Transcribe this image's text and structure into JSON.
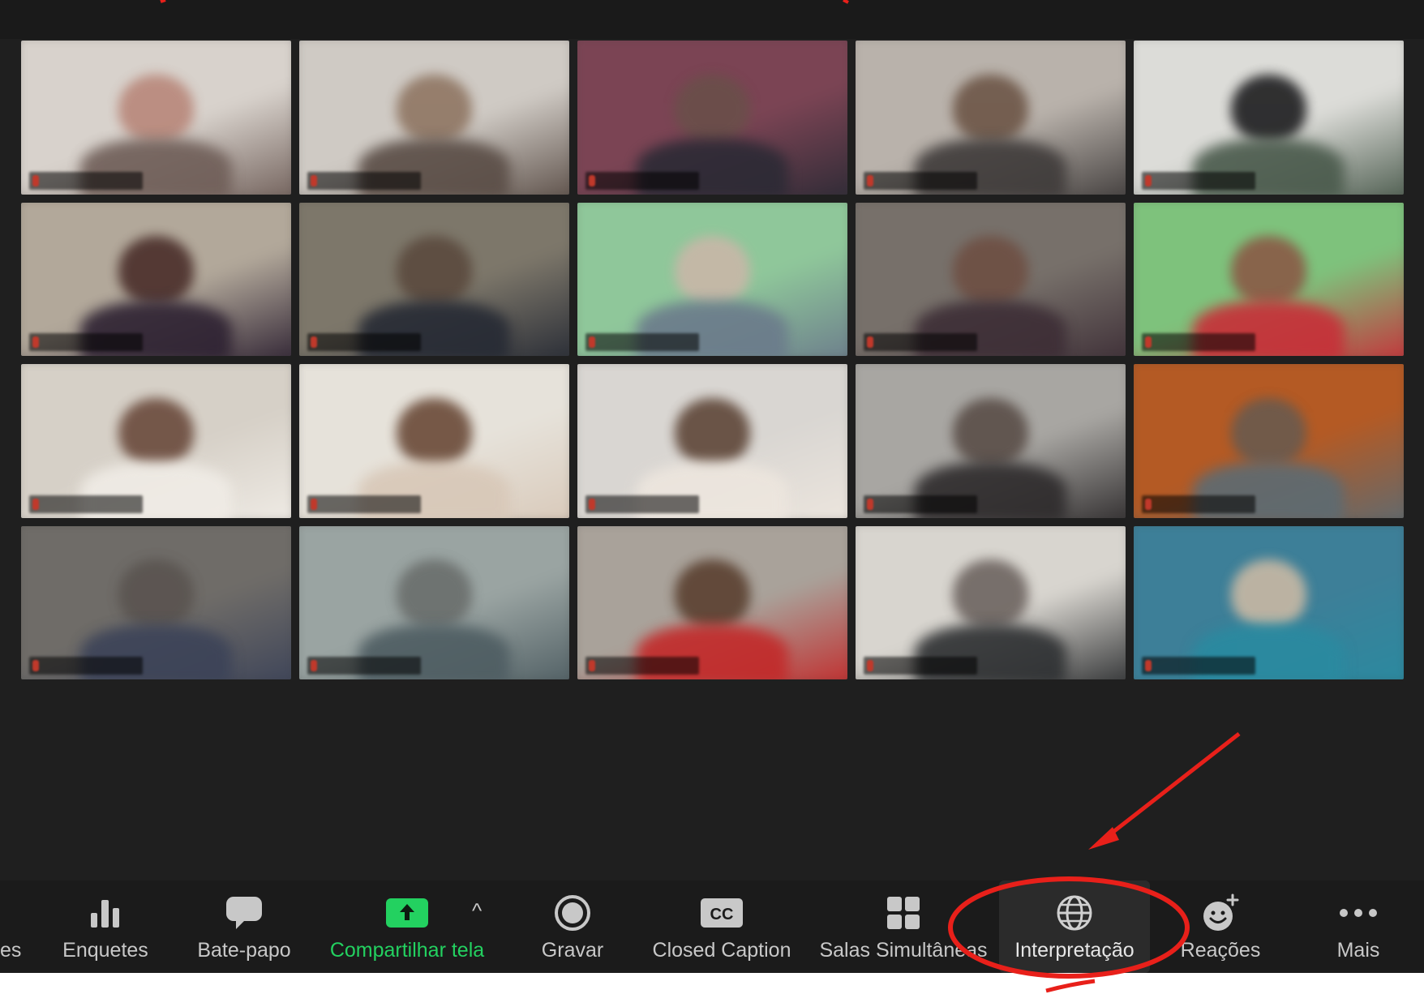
{
  "toolbar": {
    "partial_left_label": "es",
    "items": [
      {
        "id": "polls",
        "label": "Enquetes",
        "icon": "bar-chart-icon"
      },
      {
        "id": "chat",
        "label": "Bate-papo",
        "icon": "chat-bubble-icon"
      },
      {
        "id": "share",
        "label": "Compartilhar tela",
        "icon": "share-screen-arrow-icon",
        "color": "#23d160"
      },
      {
        "id": "record",
        "label": "Gravar",
        "icon": "record-circle-icon"
      },
      {
        "id": "cc",
        "label": "Closed Caption",
        "icon": "cc-icon",
        "badge": "CC"
      },
      {
        "id": "breakout",
        "label": "Salas Simultâneas",
        "icon": "grid-squares-icon"
      },
      {
        "id": "interpretation",
        "label": "Interpretação",
        "icon": "globe-icon",
        "active": true
      },
      {
        "id": "reactions",
        "label": "Reações",
        "icon": "emoji-add-icon"
      },
      {
        "id": "more",
        "label": "Mais",
        "icon": "ellipsis-icon"
      }
    ],
    "share_caret": "^"
  },
  "annotation": {
    "color": "#e8201a"
  },
  "colors": {
    "background": "#1f1f1f",
    "toolbar": "#1b1b1b",
    "share_green": "#23d160"
  }
}
